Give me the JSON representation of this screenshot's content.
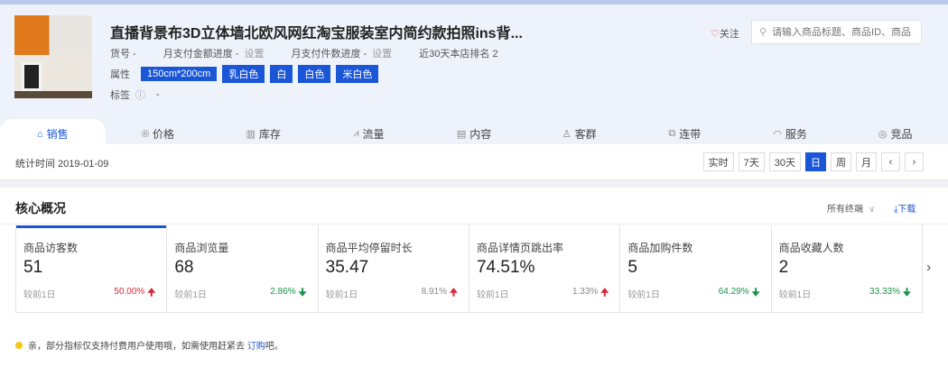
{
  "product": {
    "title": "直播背景布3D立体墙北欧风网红淘宝服装室内简约款拍照ins背...",
    "sku_label": "货号 -",
    "monthly_amount_label": "月支付金额进度 -",
    "monthly_count_label": "月支付件数进度 -",
    "set_label": "设置",
    "rank_label": "近30天本店排名 2",
    "attr_label": "属性",
    "attrs": [
      "150cm*200cm",
      "乳白色",
      "白",
      "白色",
      "米白色"
    ],
    "tag_label": "标签",
    "tag_value": "-"
  },
  "follow_label": "关注",
  "search": {
    "placeholder": "请输入商品标题、商品ID、商品"
  },
  "tabs": [
    {
      "label": "销售",
      "icon": "⌂"
    },
    {
      "label": "价格",
      "icon": "®"
    },
    {
      "label": "库存",
      "icon": "▥"
    },
    {
      "label": "流量",
      "icon": "⩘"
    },
    {
      "label": "内容",
      "icon": "▤"
    },
    {
      "label": "客群",
      "icon": "♙"
    },
    {
      "label": "连带",
      "icon": "⧉"
    },
    {
      "label": "服务",
      "icon": "◠"
    },
    {
      "label": "竞品",
      "icon": "◎"
    }
  ],
  "stat_time": "统计时间 2019-01-09",
  "periods": [
    "实时",
    "7天",
    "30天",
    "日",
    "周",
    "月",
    "‹",
    "›"
  ],
  "core": {
    "title": "核心概况",
    "terminal": "所有终端",
    "download": "下载",
    "metrics": [
      {
        "name": "商品访客数",
        "value": "51",
        "compare": "较前1日",
        "pct": "50.00%",
        "dir": "up"
      },
      {
        "name": "商品浏览量",
        "value": "68",
        "compare": "较前1日",
        "pct": "2.86%",
        "dir": "down"
      },
      {
        "name": "商品平均停留时长",
        "value": "35.47",
        "compare": "较前1日",
        "pct": "8.91%",
        "dir": "up"
      },
      {
        "name": "商品详情页跳出率",
        "value": "74.51%",
        "compare": "较前1日",
        "pct": "1.33%",
        "dir": "up"
      },
      {
        "name": "商品加购件数",
        "value": "5",
        "compare": "较前1日",
        "pct": "64.29%",
        "dir": "down"
      },
      {
        "name": "商品收藏人数",
        "value": "2",
        "compare": "较前1日",
        "pct": "33.33%",
        "dir": "down"
      }
    ]
  },
  "notice": {
    "text": "亲，部分指标仅支持付费用户使用哦，如需使用赶紧去",
    "link": "订购",
    "suffix": "吧。"
  },
  "colors": {
    "accent": "#1a56d6",
    "up": "#d9263a",
    "down": "#19934a"
  }
}
